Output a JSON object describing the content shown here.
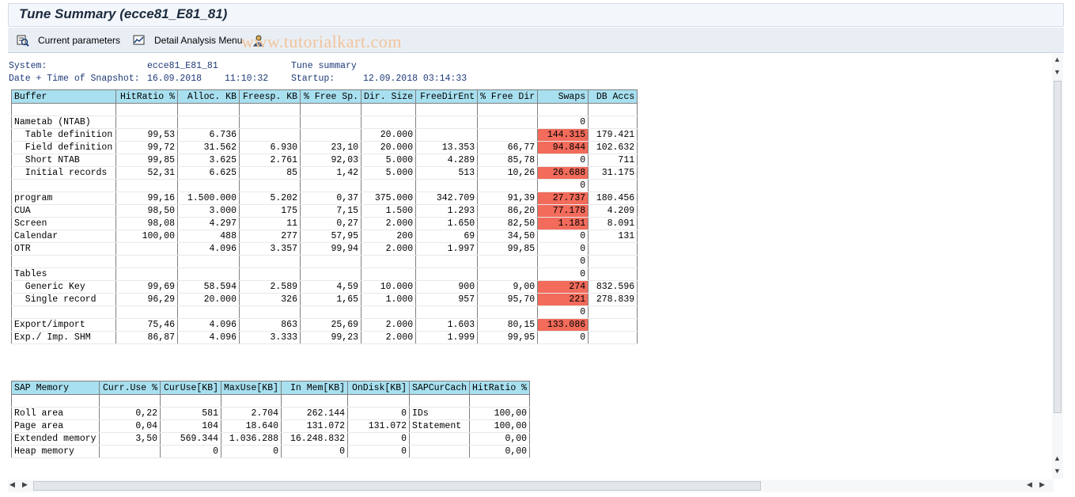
{
  "window": {
    "title": "Tune Summary (ecce81_E81_81)"
  },
  "toolbar": {
    "current_parameters": "Current parameters",
    "detail_analysis_menu": "Detail Analysis Menu",
    "watermark": "www.tutorialkart.com"
  },
  "header": {
    "system_label": "System:",
    "system_value": "ecce81_E81_81",
    "tune_label": "Tune summary",
    "snapshot_label": "Date + Time of Snapshot:",
    "snapshot_date": "16.09.2018",
    "snapshot_time": "11:10:32",
    "startup_label": "Startup:",
    "startup_value": "12.09.2018 03:14:33"
  },
  "buffer_table": {
    "columns": [
      "Buffer",
      "HitRatio %",
      "Alloc. KB",
      "Freesp. KB",
      "% Free Sp.",
      "Dir. Size",
      "FreeDirEnt",
      "% Free Dir",
      "Swaps",
      "DB Accs"
    ],
    "rows": [
      [
        "",
        "",
        "",
        "",
        "",
        "",
        "",
        "",
        "",
        ""
      ],
      [
        "Nametab (NTAB)",
        "",
        "",
        "",
        "",
        "",
        "",
        "",
        "0",
        ""
      ],
      [
        "  Table definition",
        "99,53",
        "6.736",
        "",
        "",
        "20.000",
        "",
        "",
        "144.315",
        "179.421"
      ],
      [
        "  Field definition",
        "99,72",
        "31.562",
        "6.930",
        "23,10",
        "20.000",
        "13.353",
        "66,77",
        "94.844",
        "102.632"
      ],
      [
        "  Short NTAB",
        "99,85",
        "3.625",
        "2.761",
        "92,03",
        "5.000",
        "4.289",
        "85,78",
        "0",
        "711"
      ],
      [
        "  Initial records",
        "52,31",
        "6.625",
        "85",
        "1,42",
        "5.000",
        "513",
        "10,26",
        "26.688",
        "31.175"
      ],
      [
        "",
        "",
        "",
        "",
        "",
        "",
        "",
        "",
        "0",
        ""
      ],
      [
        "program",
        "99,16",
        "1.500.000",
        "5.202",
        "0,37",
        "375.000",
        "342.709",
        "91,39",
        "27.737",
        "180.456"
      ],
      [
        "CUA",
        "98,50",
        "3.000",
        "175",
        "7,15",
        "1.500",
        "1.293",
        "86,20",
        "77.178",
        "4.209"
      ],
      [
        "Screen",
        "98,08",
        "4.297",
        "11",
        "0,27",
        "2.000",
        "1.650",
        "82,50",
        "1.181",
        "8.091"
      ],
      [
        "Calendar",
        "100,00",
        "488",
        "277",
        "57,95",
        "200",
        "69",
        "34,50",
        "0",
        "131"
      ],
      [
        "OTR",
        "",
        "4.096",
        "3.357",
        "99,94",
        "2.000",
        "1.997",
        "99,85",
        "0",
        ""
      ],
      [
        "",
        "",
        "",
        "",
        "",
        "",
        "",
        "",
        "0",
        ""
      ],
      [
        "Tables",
        "",
        "",
        "",
        "",
        "",
        "",
        "",
        "0",
        ""
      ],
      [
        "  Generic Key",
        "99,69",
        "58.594",
        "2.589",
        "4,59",
        "10.000",
        "900",
        "9,00",
        "274",
        "832.596"
      ],
      [
        "  Single record",
        "96,29",
        "20.000",
        "326",
        "1,65",
        "1.000",
        "957",
        "95,70",
        "221",
        "278.839"
      ],
      [
        "",
        "",
        "",
        "",
        "",
        "",
        "",
        "",
        "0",
        ""
      ],
      [
        "Export/import",
        "75,46",
        "4.096",
        "863",
        "25,69",
        "2.000",
        "1.603",
        "80,15",
        "133.086",
        ""
      ],
      [
        "Exp./ Imp. SHM",
        "86,87",
        "4.096",
        "3.333",
        "99,23",
        "2.000",
        "1.999",
        "99,95",
        "0",
        ""
      ]
    ],
    "highlighted_swaps_rows": [
      2,
      3,
      5,
      7,
      8,
      9,
      14,
      15,
      17
    ],
    "highlight_color": "#f26b5b"
  },
  "memory_table": {
    "columns": [
      "SAP Memory",
      "Curr.Use %",
      "CurUse[KB]",
      "MaxUse[KB]",
      "In Mem[KB]",
      "OnDisk[KB]",
      "SAPCurCach",
      "HitRatio %"
    ],
    "rows": [
      [
        "",
        "",
        "",
        "",
        "",
        "",
        "",
        ""
      ],
      [
        "Roll area",
        "0,22",
        "581",
        "2.704",
        "262.144",
        "0",
        "IDs",
        "100,00"
      ],
      [
        "Page area",
        "0,04",
        "104",
        "18.640",
        "131.072",
        "131.072",
        "Statement",
        "100,00"
      ],
      [
        "Extended memory",
        "3,50",
        "569.344",
        "1.036.288",
        "16.248.832",
        "0",
        "",
        "0,00"
      ],
      [
        "Heap memory",
        "",
        "0",
        "0",
        "0",
        "0",
        "",
        "0,00"
      ]
    ]
  },
  "header_color": "#a8e0f0"
}
